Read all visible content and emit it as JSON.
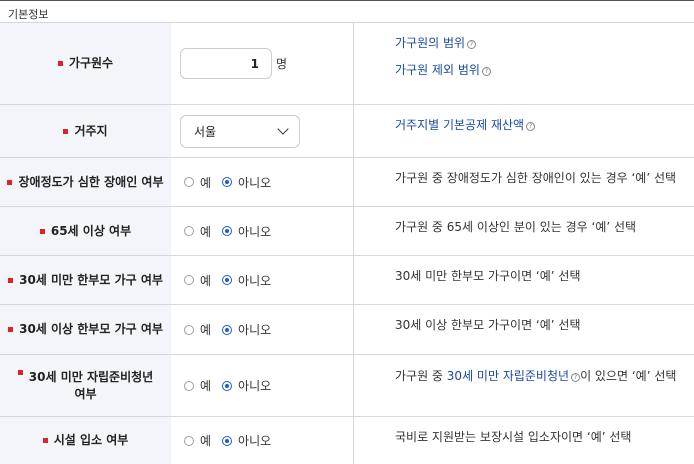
{
  "section": {
    "title": "기본정보"
  },
  "rows": {
    "household": {
      "label": "가구원수",
      "value": "1",
      "unit": "명",
      "info_link1": "가구원의 범위",
      "info_link2": "가구원 제외 범위"
    },
    "residence": {
      "label": "거주지",
      "selected": "서울",
      "info_link": "거주지별 기본공제 재산액"
    },
    "disability": {
      "label": "장애정도가 심한 장애인 여부",
      "yes": "예",
      "no": "아니오",
      "info": "가구원 중 장애정도가 심한 장애인이 있는 경우 ‘예’ 선택"
    },
    "senior": {
      "label": "65세 이상 여부",
      "yes": "예",
      "no": "아니오",
      "info": "가구원 중 65세 이상인 분이 있는 경우 ‘예’ 선택"
    },
    "single_parent_under30": {
      "label": "30세 미만 한부모 가구 여부",
      "yes": "예",
      "no": "아니오",
      "info": "30세 미만 한부모 가구이면 ‘예’ 선택"
    },
    "single_parent_over30": {
      "label": "30세 이상 한부모 가구 여부",
      "yes": "예",
      "no": "아니오",
      "info": "30세 이상 한부모 가구이면 ‘예’ 선택"
    },
    "youth": {
      "label": "30세 미만 자립준비청년 여부",
      "yes": "예",
      "no": "아니오",
      "info_prefix": "가구원 중 ",
      "info_link": "30세 미만 자립준비청년",
      "info_suffix": "이 있으면 ‘예’ 선택"
    },
    "facility": {
      "label": "시설 입소 여부",
      "yes": "예",
      "no": "아니오",
      "info": "국비로 지원받는 보장시설 입소자이면 ‘예’ 선택"
    }
  },
  "icons": {
    "info": "info-circle-icon",
    "dropdown": "chevron-down-icon",
    "required": "required-marker"
  },
  "colors": {
    "label_bg": "#f4f5fa",
    "required": "#d8232a",
    "link": "#1b4aa3",
    "radio_checked": "#1f5ad1"
  }
}
